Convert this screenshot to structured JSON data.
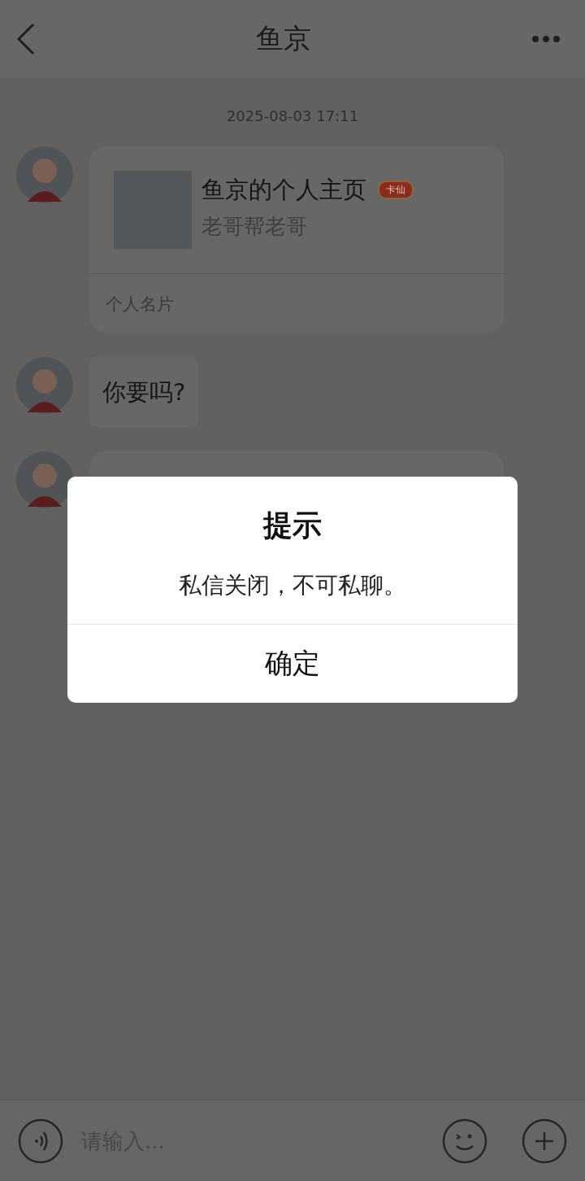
{
  "header": {
    "title": "鱼京"
  },
  "timestamp": "2025-08-03 17:11",
  "messages": [
    {
      "kind": "card",
      "title": "鱼京的个人主页",
      "badge": "卡仙",
      "subtitle": "老哥帮老哥",
      "footer": "个人名片"
    },
    {
      "kind": "text",
      "text": "你要吗?"
    },
    {
      "kind": "blank"
    }
  ],
  "dialog": {
    "title": "提示",
    "message": "私信关闭，不可私聊。",
    "button": "确定"
  },
  "input": {
    "placeholder": "请输入..."
  }
}
